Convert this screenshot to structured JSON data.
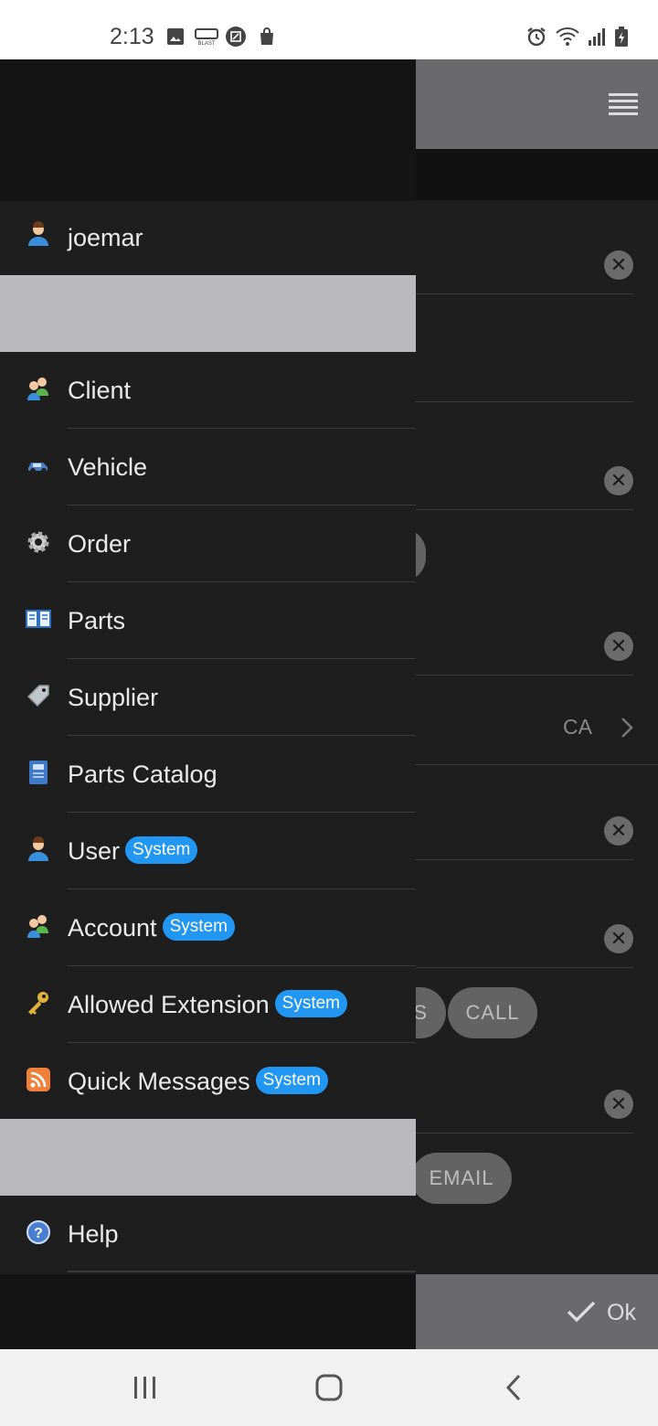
{
  "status_bar": {
    "time": "2:13",
    "left_icons": [
      "image-icon",
      "blast-icon",
      "edit-box-icon",
      "shopping-bag-icon"
    ],
    "right_icons": [
      "alarm-icon",
      "wifi-icon",
      "signal-icon",
      "battery-charging-icon"
    ]
  },
  "drawer": {
    "user": {
      "name": "joemar",
      "icon": "user-icon"
    },
    "items": [
      {
        "label": "Client",
        "icon": "client-icon",
        "badge": ""
      },
      {
        "label": "Vehicle",
        "icon": "vehicle-icon",
        "badge": ""
      },
      {
        "label": "Order",
        "icon": "gear-icon",
        "badge": ""
      },
      {
        "label": "Parts",
        "icon": "book-icon",
        "badge": ""
      },
      {
        "label": "Supplier",
        "icon": "tag-icon",
        "badge": ""
      },
      {
        "label": "Parts Catalog",
        "icon": "catalog-icon",
        "badge": ""
      },
      {
        "label": "User",
        "icon": "user-icon",
        "badge": "System"
      },
      {
        "label": "Account",
        "icon": "account-icon",
        "badge": "System"
      },
      {
        "label": "Allowed Extension",
        "icon": "key-icon",
        "badge": "System"
      },
      {
        "label": "Quick Messages",
        "icon": "rss-icon",
        "badge": "System"
      }
    ],
    "help": {
      "label": "Help",
      "icon": "help-icon"
    }
  },
  "background": {
    "country_value": "CA",
    "call_button": "CALL",
    "partial_button": "S",
    "email_button": "EMAIL",
    "ok_label": "Ok"
  },
  "colors": {
    "badge": "#2196f3",
    "drawer_bg": "#1e1e1e",
    "separator": "#b9b9be"
  }
}
